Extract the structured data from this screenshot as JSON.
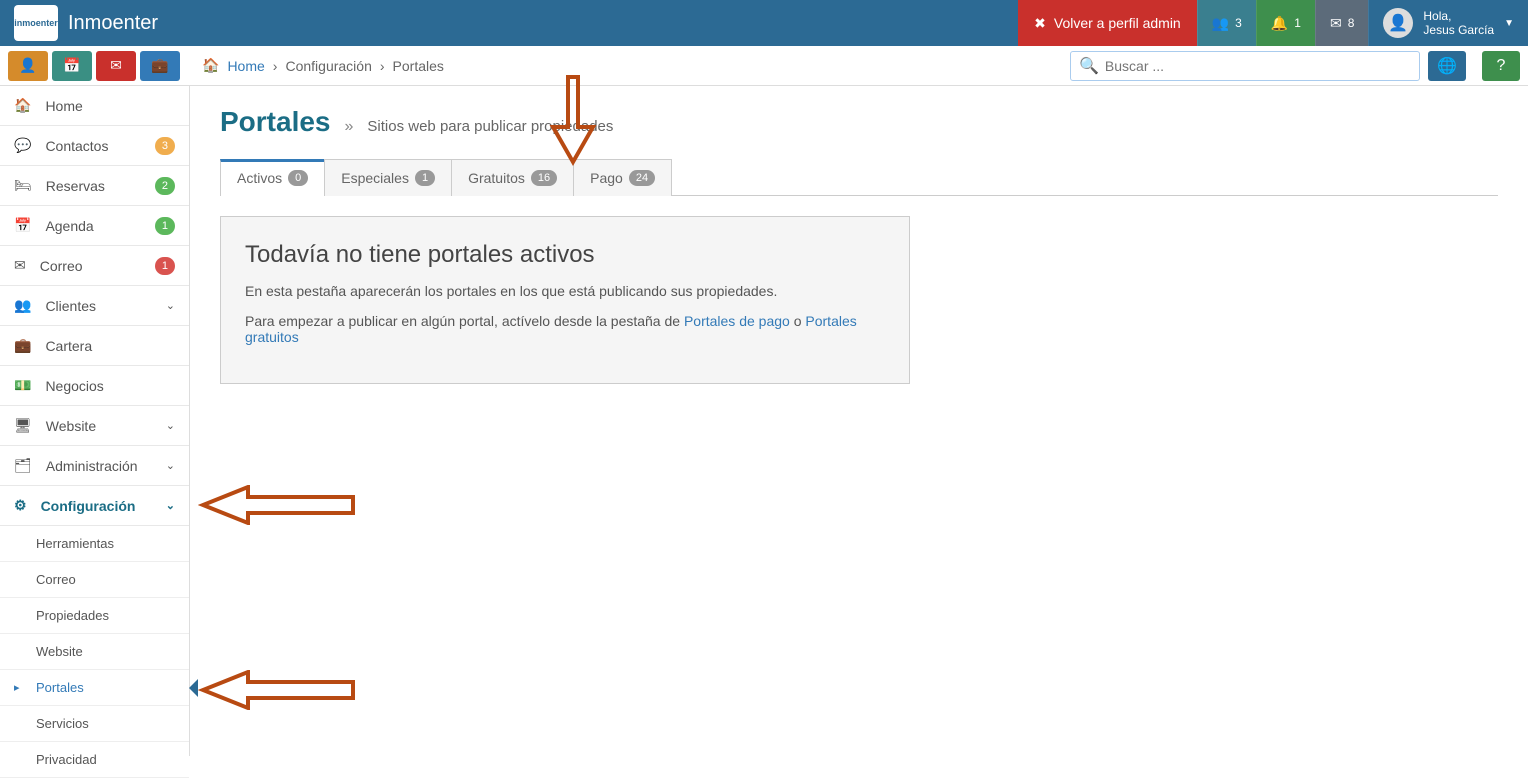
{
  "brand": "Inmoenter",
  "logo_text": "inmoenter",
  "header": {
    "admin_label": "Volver a perfil admin",
    "users_count": "3",
    "bell_count": "1",
    "mail_count": "8",
    "greet": "Hola,",
    "username": "Jesus García"
  },
  "breadcrumb": {
    "home": "Home",
    "level1": "Configuración",
    "level2": "Portales"
  },
  "search": {
    "placeholder": "Buscar ..."
  },
  "sidebar": {
    "items": [
      {
        "icon": "home",
        "label": "Home"
      },
      {
        "icon": "comment",
        "label": "Contactos",
        "badge": "3",
        "badge_color": "orange"
      },
      {
        "icon": "bed",
        "label": "Reservas",
        "badge": "2",
        "badge_color": "green"
      },
      {
        "icon": "calendar",
        "label": "Agenda",
        "badge": "1",
        "badge_color": "green"
      },
      {
        "icon": "envelope",
        "label": "Correo",
        "badge": "1",
        "badge_color": "red"
      },
      {
        "icon": "users",
        "label": "Clientes",
        "chev": true
      },
      {
        "icon": "briefcase",
        "label": "Cartera"
      },
      {
        "icon": "money",
        "label": "Negocios"
      },
      {
        "icon": "desktop",
        "label": "Website",
        "chev": true
      },
      {
        "icon": "sitemap",
        "label": "Administración",
        "chev": true
      },
      {
        "icon": "cogs",
        "label": "Configuración",
        "chev": true,
        "active": true
      }
    ],
    "config_sub": [
      {
        "label": "Herramientas"
      },
      {
        "label": "Correo"
      },
      {
        "label": "Propiedades"
      },
      {
        "label": "Website"
      },
      {
        "label": "Portales",
        "active": true
      },
      {
        "label": "Servicios"
      },
      {
        "label": "Privacidad"
      }
    ]
  },
  "page": {
    "title": "Portales",
    "subtitle": "Sitios web para publicar propiedades",
    "tabs": [
      {
        "label": "Activos",
        "count": "0",
        "active": true
      },
      {
        "label": "Especiales",
        "count": "1"
      },
      {
        "label": "Gratuitos",
        "count": "16"
      },
      {
        "label": "Pago",
        "count": "24"
      }
    ],
    "panel": {
      "heading": "Todavía no tiene portales activos",
      "line1": "En esta pestaña aparecerán los portales en los que está publicando sus propiedades.",
      "line2_pre": "Para empezar a publicar en algún portal, actívelo desde la pestaña de ",
      "link1": "Portales de pago",
      "line2_mid": " o ",
      "link2": "Portales gratuitos"
    }
  },
  "icons": {
    "home": "⌂",
    "comment": "💬",
    "bed": "🛏",
    "calendar": "📅",
    "envelope": "✉",
    "users": "👥",
    "briefcase": "💼",
    "money": "⊡",
    "desktop": "🖥",
    "sitemap": "⚙",
    "cogs": "⚙⚙"
  }
}
